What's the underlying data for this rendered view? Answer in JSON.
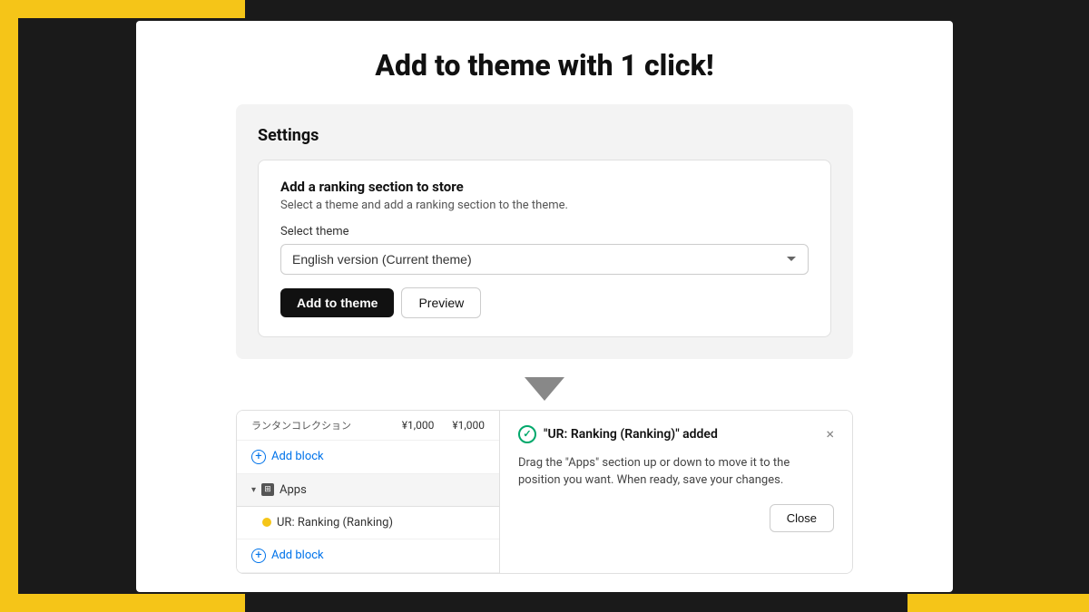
{
  "page": {
    "title": "Add to theme with 1 click!",
    "bg_color": "#1a1a1a",
    "accent_color": "#F5C518"
  },
  "settings": {
    "heading": "Settings",
    "card": {
      "title": "Add a ranking section to store",
      "description": "Select a theme and add a ranking section to the theme.",
      "select_label": "Select theme",
      "select_value": "English version (Current theme)",
      "btn_add": "Add to theme",
      "btn_preview": "Preview"
    }
  },
  "bottom": {
    "left_panel": {
      "product_row": {
        "col1": "¥1,000",
        "col2": "¥1,000"
      },
      "add_block_1": "Add block",
      "apps_label": "Apps",
      "ranking_label": "UR: Ranking (Ranking)",
      "add_block_2": "Add block"
    },
    "right_panel": {
      "notification_title": "\"UR: Ranking (Ranking)\" added",
      "notification_body": "Drag the \"Apps\" section up or down to move it to the position you want. When ready, save your changes.",
      "btn_close": "Close"
    }
  }
}
